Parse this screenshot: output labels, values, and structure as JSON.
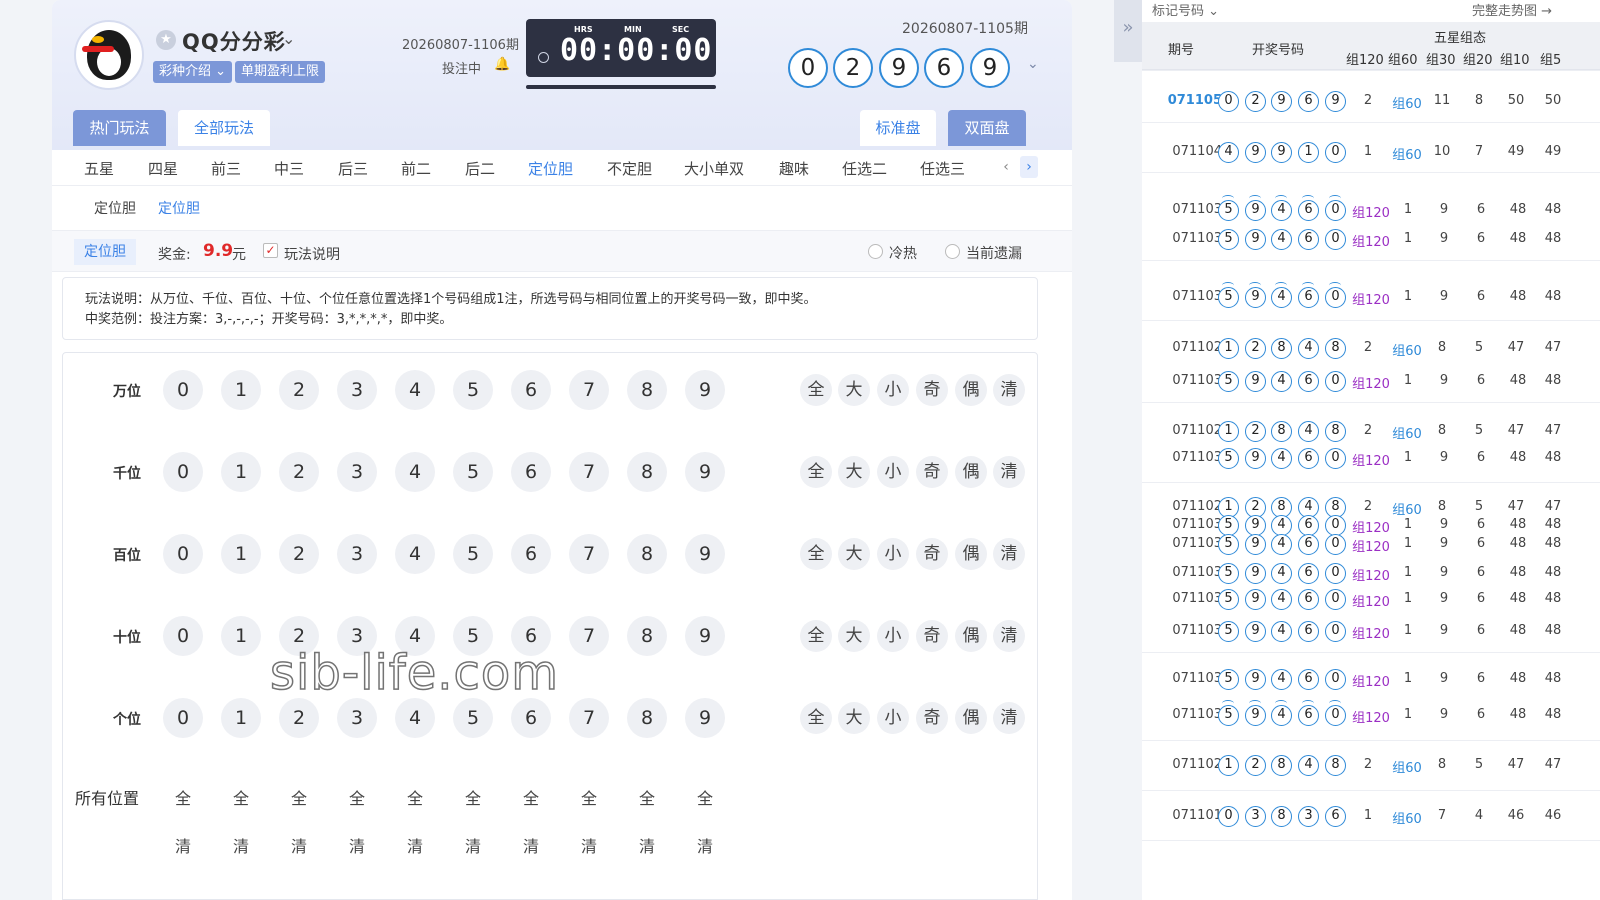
{
  "header": {
    "game_title": "QQ分分彩",
    "tag_intro": "彩种介绍",
    "tag_limit": "单期盈利上限",
    "issue_next": "20260807-1106期",
    "bet_status": "投注中",
    "timer": {
      "hrs_label": "HRS",
      "min_label": "MIN",
      "sec_label": "SEC",
      "value": "00:00:00"
    },
    "issue_last": "20260807-1105期",
    "last_result": [
      "0",
      "2",
      "9",
      "6",
      "9"
    ]
  },
  "top_tabs": {
    "hot": "热门玩法",
    "all": "全部玩法",
    "standard": "标准盘",
    "double": "双面盘"
  },
  "play_tabs": [
    "五星",
    "四星",
    "前三",
    "中三",
    "后三",
    "前二",
    "后二",
    "定位胆",
    "不定胆",
    "大小单双",
    "趣味",
    "任选二",
    "任选三"
  ],
  "play_tabs_active": "定位胆",
  "sub_tabs": [
    "定位胆",
    "定位胆"
  ],
  "options": {
    "mode": "定位胆",
    "prize_label": "奖金:",
    "prize_value": "9.9",
    "prize_unit": "元",
    "rules_check": "✓",
    "rules_label": "玩法说明",
    "radio_hot": "冷热",
    "radio_miss": "当前遗漏"
  },
  "description": {
    "line1": "玩法说明：从万位、千位、百位、十位、个位任意位置选择1个号码组成1注，所选号码与相同位置上的开奖号码一致，即中奖。",
    "line2": "中奖范例：投注方案：3,-,-,-,-；开奖号码：3,*,*,*,*，即中奖。"
  },
  "board": {
    "positions": [
      "万位",
      "千位",
      "百位",
      "十位",
      "个位"
    ],
    "numbers": [
      "0",
      "1",
      "2",
      "3",
      "4",
      "5",
      "6",
      "7",
      "8",
      "9"
    ],
    "quick": [
      "全",
      "大",
      "小",
      "奇",
      "偶",
      "清"
    ],
    "all_positions_label": "所有位置",
    "all_label": "全",
    "clear_label": "清"
  },
  "watermark": "sib-life.com",
  "right_panel": {
    "mark_label": "标记号码",
    "full_trend": "完整走势图",
    "headers": {
      "issue": "期号",
      "number": "开奖号码",
      "group_state": "五星组态",
      "g120": "组120",
      "g60": "组60",
      "g30": "组30",
      "g20": "组20",
      "g10": "组10",
      "g5": "组5"
    },
    "rows": [
      {
        "issue": "071105",
        "balls": [
          "0",
          "2",
          "9",
          "6",
          "9"
        ],
        "pair": "2",
        "group": "组60",
        "n1": "11",
        "n2": "8",
        "n3": "50",
        "n4": "50",
        "highlight": true
      },
      {
        "issue": "071104",
        "balls": [
          "4",
          "9",
          "9",
          "1",
          "0"
        ],
        "pair": "1",
        "group": "组60",
        "n1": "10",
        "n2": "7",
        "n3": "49",
        "n4": "49"
      },
      {
        "issue": "071103",
        "balls": [
          "5",
          "9",
          "4",
          "6",
          "0"
        ],
        "pair": "",
        "group": "组120",
        "n1": "1",
        "n2": "9",
        "n3": "6",
        "n4": "48",
        "n5": "48",
        "arc": true
      },
      {
        "issue": "071103",
        "balls": [
          "5",
          "9",
          "4",
          "6",
          "0"
        ],
        "pair": "",
        "group": "组120",
        "n1": "1",
        "n2": "9",
        "n3": "6",
        "n4": "48",
        "n5": "48"
      },
      {
        "issue": "071103",
        "balls": [
          "5",
          "9",
          "4",
          "6",
          "0"
        ],
        "pair": "",
        "group": "组120",
        "n1": "1",
        "n2": "9",
        "n3": "6",
        "n4": "48",
        "n5": "48",
        "arc": true
      },
      {
        "issue": "071102",
        "balls": [
          "1",
          "2",
          "8",
          "4",
          "8"
        ],
        "pair": "2",
        "group": "组60",
        "n1": "8",
        "n2": "5",
        "n3": "47",
        "n4": "47"
      },
      {
        "issue": "071103",
        "balls": [
          "5",
          "9",
          "4",
          "6",
          "0"
        ],
        "pair": "",
        "group": "组120",
        "n1": "1",
        "n2": "9",
        "n3": "6",
        "n4": "48",
        "n5": "48"
      },
      {
        "issue": "071102",
        "balls": [
          "1",
          "2",
          "8",
          "4",
          "8"
        ],
        "pair": "2",
        "group": "组60",
        "n1": "8",
        "n2": "5",
        "n3": "47",
        "n4": "47"
      },
      {
        "issue": "071103",
        "balls": [
          "5",
          "9",
          "4",
          "6",
          "0"
        ],
        "pair": "",
        "group": "组120",
        "n1": "1",
        "n2": "9",
        "n3": "6",
        "n4": "48",
        "n5": "48"
      },
      {
        "issue": "071102",
        "balls": [
          "1",
          "2",
          "8",
          "4",
          "8"
        ],
        "pair": "2",
        "group": "组60",
        "n1": "8",
        "n2": "5",
        "n3": "47",
        "n4": "47"
      },
      {
        "issue": "071103",
        "balls": [
          "5",
          "9",
          "4",
          "6",
          "0"
        ],
        "pair": "",
        "group": "组120",
        "n1": "1",
        "n2": "9",
        "n3": "6",
        "n4": "48",
        "n5": "48"
      },
      {
        "issue": "071103",
        "balls": [
          "5",
          "9",
          "4",
          "6",
          "0"
        ],
        "pair": "",
        "group": "组120",
        "n1": "1",
        "n2": "9",
        "n3": "6",
        "n4": "48",
        "n5": "48"
      },
      {
        "issue": "071103",
        "balls": [
          "5",
          "9",
          "4",
          "6",
          "0"
        ],
        "pair": "",
        "group": "组120",
        "n1": "1",
        "n2": "9",
        "n3": "6",
        "n4": "48",
        "n5": "48"
      },
      {
        "issue": "071103",
        "balls": [
          "5",
          "9",
          "4",
          "6",
          "0"
        ],
        "pair": "",
        "group": "组120",
        "n1": "1",
        "n2": "9",
        "n3": "6",
        "n4": "48",
        "n5": "48"
      },
      {
        "issue": "071103",
        "balls": [
          "5",
          "9",
          "4",
          "6",
          "0"
        ],
        "pair": "",
        "group": "组120",
        "n1": "1",
        "n2": "9",
        "n3": "6",
        "n4": "48",
        "n5": "48"
      },
      {
        "issue": "071103",
        "balls": [
          "5",
          "9",
          "4",
          "6",
          "0"
        ],
        "pair": "",
        "group": "组120",
        "n1": "1",
        "n2": "9",
        "n3": "6",
        "n4": "48",
        "n5": "48"
      },
      {
        "issue": "071103",
        "balls": [
          "5",
          "9",
          "4",
          "6",
          "0"
        ],
        "pair": "",
        "group": "组120",
        "n1": "1",
        "n2": "9",
        "n3": "6",
        "n4": "48",
        "n5": "48",
        "arc": true
      },
      {
        "issue": "071102",
        "balls": [
          "1",
          "2",
          "8",
          "4",
          "8"
        ],
        "pair": "2",
        "group": "组60",
        "n1": "8",
        "n2": "5",
        "n3": "47",
        "n4": "47"
      },
      {
        "issue": "071101",
        "balls": [
          "0",
          "3",
          "8",
          "3",
          "6"
        ],
        "pair": "1",
        "group": "组60",
        "n1": "7",
        "n2": "4",
        "n3": "46",
        "n4": "46"
      }
    ]
  }
}
